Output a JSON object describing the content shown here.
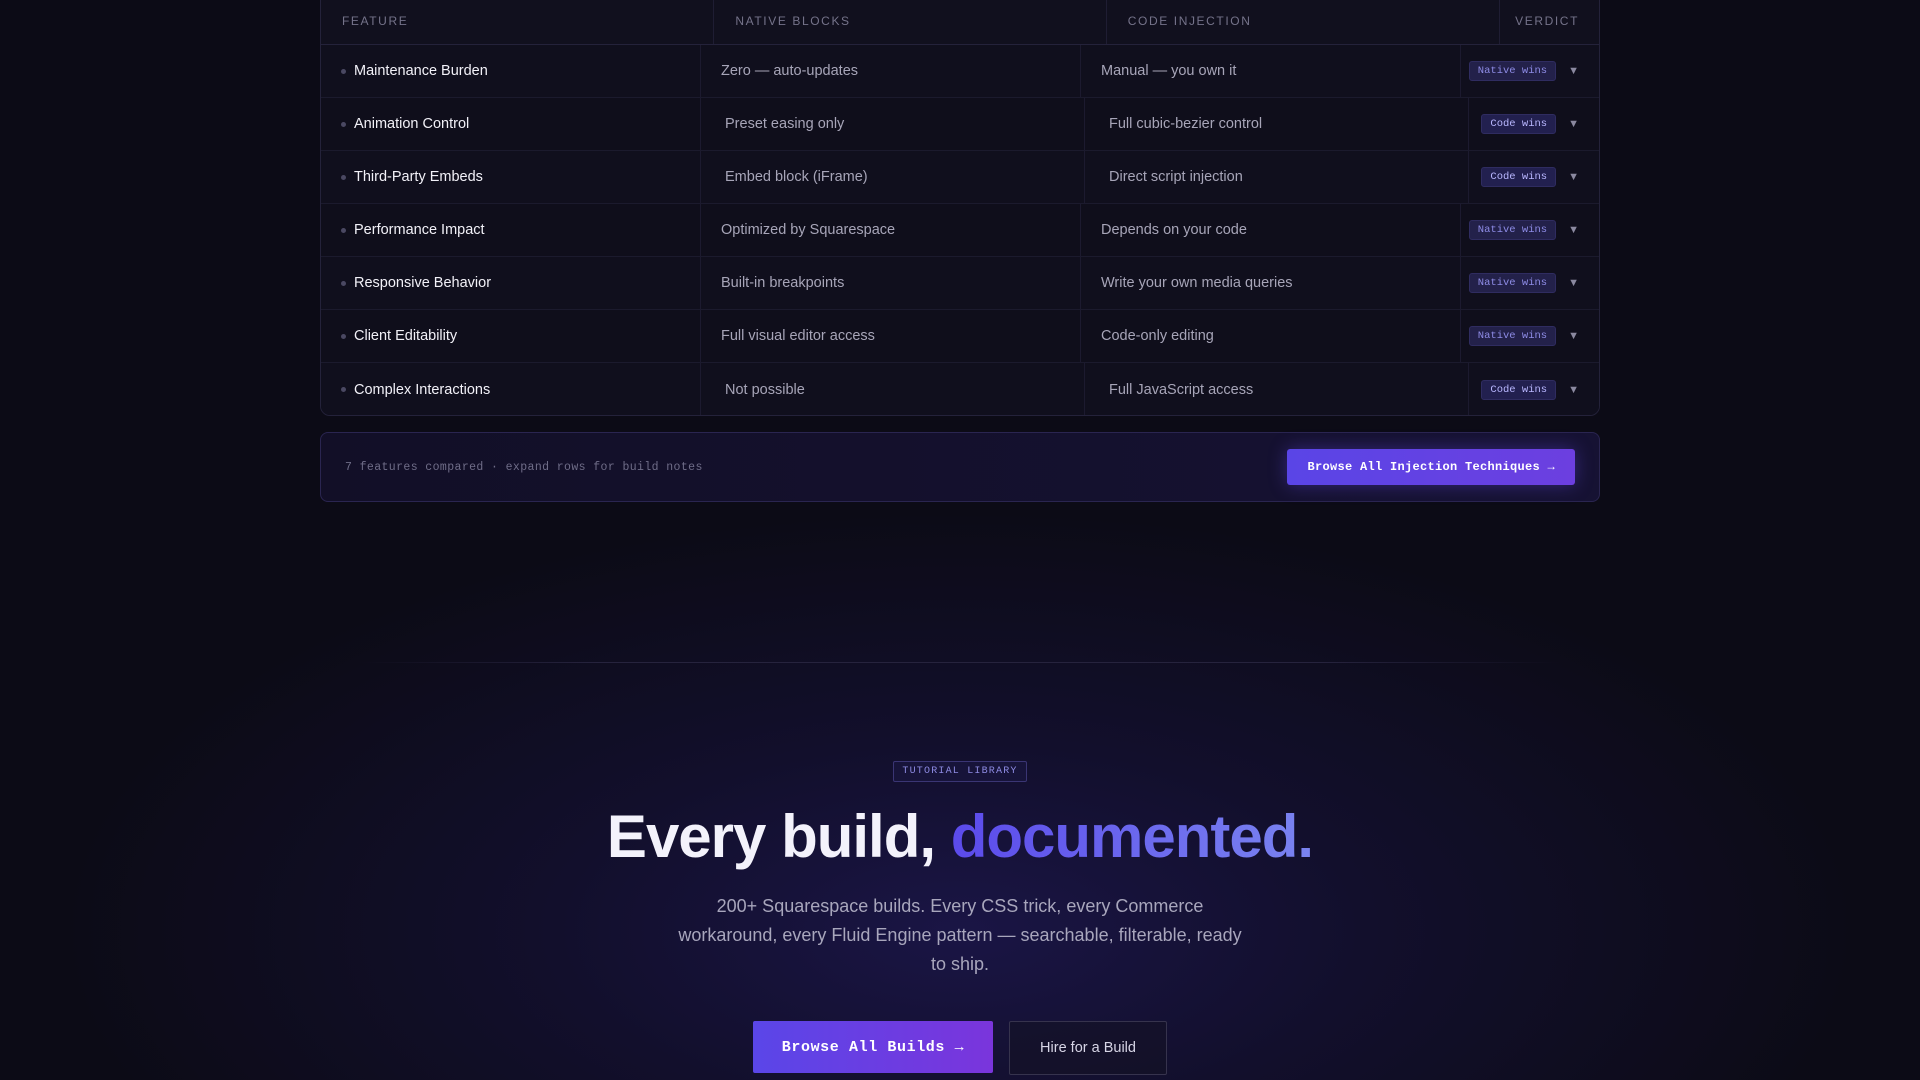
{
  "table": {
    "headers": [
      "FEATURE",
      "NATIVE BLOCKS",
      "CODE INJECTION",
      "VERDICT"
    ],
    "rows": [
      {
        "feature": "Maintenance Burden",
        "native": "Zero — auto-updates",
        "code": "Manual — you own it",
        "verdict": "Native wins"
      },
      {
        "feature": "Animation Control",
        "native": "Preset easing only",
        "code": "Full cubic-bezier control",
        "verdict": "Code wins"
      },
      {
        "feature": "Third-Party Embeds",
        "native": "Embed block (iFrame)",
        "code": "Direct script injection",
        "verdict": "Code wins"
      },
      {
        "feature": "Performance Impact",
        "native": "Optimized by Squarespace",
        "code": "Depends on your code",
        "verdict": "Native wins"
      },
      {
        "feature": "Responsive Behavior",
        "native": "Built-in breakpoints",
        "code": "Write your own media queries",
        "verdict": "Native wins"
      },
      {
        "feature": "Client Editability",
        "native": "Full visual editor access",
        "code": "Code-only editing",
        "verdict": "Native wins"
      },
      {
        "feature": "Complex Interactions",
        "native": "Not possible",
        "code": "Full JavaScript access",
        "verdict": "Code wins"
      }
    ],
    "expand_icon": "chevron-down-icon"
  },
  "footer": {
    "note": "7 features compared · expand rows for build notes",
    "button_label": "Browse All Injection Techniques →"
  },
  "hero": {
    "tag": "TUTORIAL LIBRARY",
    "title_main": "Every build, ",
    "title_accent": "documented.",
    "subtitle": "200+ Squarespace builds. Every CSS trick, every Commerce workaround, every Fluid Engine pattern — searchable, filterable, ready to ship.",
    "primary_cta": "Browse All Builds →",
    "secondary_cta": "Hire for a Build"
  },
  "colors": {
    "accent": "#5a46e8",
    "background": "#0c0b16"
  }
}
